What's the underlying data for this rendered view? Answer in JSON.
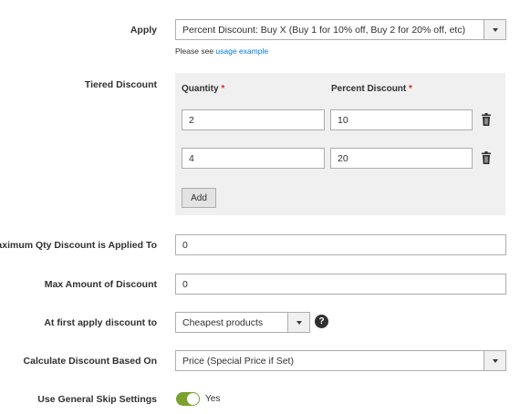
{
  "apply": {
    "label": "Apply",
    "value": "Percent Discount: Buy X (Buy 1 for 10% off, Buy 2 for 20% off, etc)",
    "note_prefix": "Please see ",
    "note_link": "usage example"
  },
  "tiered": {
    "label": "Tiered Discount",
    "qty_header": "Quantity",
    "pct_header": "Percent Discount",
    "required_mark": "*",
    "rows": [
      {
        "quantity": "2",
        "percent": "10"
      },
      {
        "quantity": "4",
        "percent": "20"
      }
    ],
    "add_label": "Add"
  },
  "max_qty": {
    "label": "Maximum Qty Discount is Applied To",
    "value": "0"
  },
  "max_amount": {
    "label": "Max Amount of Discount",
    "value": "0"
  },
  "first_apply": {
    "label": "At first apply discount to",
    "value": "Cheapest products",
    "help": "?"
  },
  "calc_based": {
    "label": "Calculate Discount Based On",
    "value": "Price (Special Price if Set)"
  },
  "skip": {
    "label": "Use General Skip Settings",
    "toggle_on": true,
    "value": "Yes"
  },
  "colors": {
    "toggle_on": "#79a22e",
    "link": "#007bdb",
    "required": "#e22626"
  },
  "icons": {
    "trash": "trash-icon",
    "help": "question-circle-icon",
    "dropdown": "chevron-down-icon"
  }
}
